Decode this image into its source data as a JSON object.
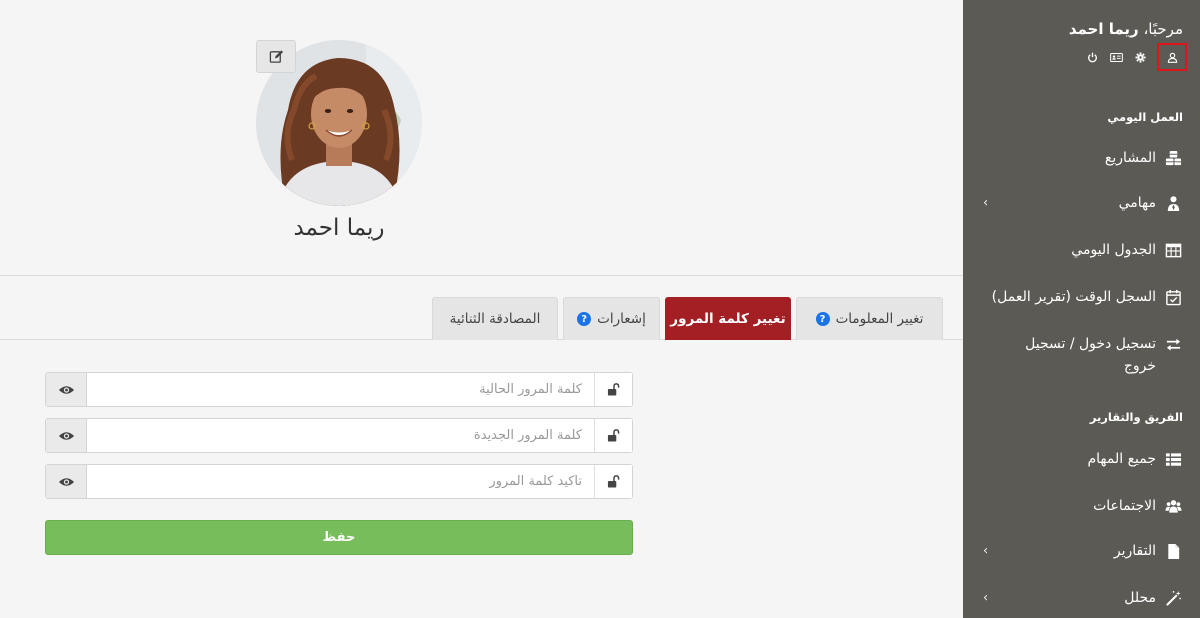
{
  "sidebar": {
    "greeting_prefix": "مرحبًا،",
    "user_name": "ريما احمد",
    "top_icons": [
      "power-icon",
      "id-card-icon",
      "gear-icon",
      "user-icon"
    ],
    "sections": [
      {
        "title": "العمل اليومي",
        "items": [
          {
            "label": "المشاريع",
            "icon": "cubes-icon",
            "has_submenu": false
          },
          {
            "label": "مهامي",
            "icon": "user-tie-icon",
            "has_submenu": true
          },
          {
            "label": "الجدول اليومي",
            "icon": "table-icon",
            "has_submenu": false
          },
          {
            "label": "السجل الوقت (تقرير العمل)",
            "icon": "calendar-check-icon",
            "has_submenu": false
          },
          {
            "label": "تسجيل دخول / تسجيل خروج",
            "icon": "exchange-icon",
            "has_submenu": false
          }
        ]
      },
      {
        "title": "الفريق والتقارير",
        "items": [
          {
            "label": "جميع المهام",
            "icon": "list-icon",
            "has_submenu": false
          },
          {
            "label": "الاجتماعات",
            "icon": "users-icon",
            "has_submenu": false
          },
          {
            "label": "التقارير",
            "icon": "file-icon",
            "has_submenu": true
          },
          {
            "label": "محلل",
            "icon": "magic-wand-icon",
            "has_submenu": true
          }
        ]
      }
    ]
  },
  "profile": {
    "name": "ريما احمد"
  },
  "tabs": [
    {
      "label": "تغيير المعلومات",
      "help": true,
      "active": false
    },
    {
      "label": "تغيير كلمة المرور",
      "help": false,
      "active": true
    },
    {
      "label": "إشعارات",
      "help": true,
      "active": false
    },
    {
      "label": "المصادقة الثنائية",
      "help": false,
      "active": false
    }
  ],
  "help_glyph": "?",
  "form": {
    "fields": [
      {
        "placeholder": "كلمة المرور الحالية",
        "value": ""
      },
      {
        "placeholder": "كلمة المرور الجديدة",
        "value": ""
      },
      {
        "placeholder": "تأكيد كلمة المرور",
        "value": ""
      }
    ],
    "save_label": "حفظ"
  },
  "colors": {
    "sidebar_bg": "#5b5a55",
    "active_tab": "#a41f24",
    "save_button": "#77bd5b",
    "highlight_border": "#e0151b",
    "help_icon": "#1a73e8"
  }
}
